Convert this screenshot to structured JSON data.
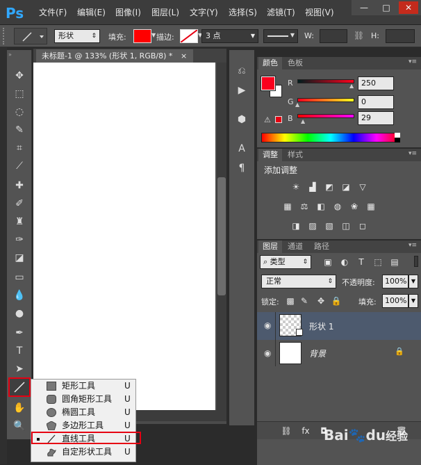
{
  "app": {
    "logo": "Ps",
    "menu": [
      "文件(F)",
      "编辑(E)",
      "图像(I)",
      "图层(L)",
      "文字(Y)",
      "选择(S)",
      "滤镜(T)",
      "视图(V)"
    ],
    "window_controls": [
      "—",
      "□",
      "✕"
    ]
  },
  "options_bar": {
    "mode_label": "形状",
    "fill_label": "填充:",
    "stroke_label": "描边:",
    "stroke_size": "3 点",
    "width_label": "W:",
    "height_label": "H:",
    "fill_color": "#ff0000",
    "accent": "#e60012"
  },
  "document": {
    "tab_title": "未标题-1 @ 133% (形状 1, RGB/8) *",
    "close_glyph": "×"
  },
  "color_panel": {
    "tabs": [
      "颜色",
      "色板"
    ],
    "r_label": "R",
    "r_value": "250",
    "g_label": "G",
    "g_value": "0",
    "b_label": "B",
    "b_value": "29",
    "foreground": "#fa001d",
    "background": "#ffffff"
  },
  "adjustments_panel": {
    "tabs": [
      "调整",
      "样式"
    ],
    "title": "添加调整"
  },
  "layers_panel": {
    "tabs": [
      "图层",
      "通道",
      "路径"
    ],
    "filter_label": "类型",
    "blend_mode": "正常",
    "opacity_label": "不透明度:",
    "opacity_value": "100%",
    "lock_label": "锁定:",
    "fill_label": "填充:",
    "fill_value": "100%",
    "layers": [
      {
        "name": "形状 1",
        "selected": true
      },
      {
        "name": "背景",
        "selected": false
      }
    ]
  },
  "flyout": {
    "items": [
      {
        "label": "矩形工具",
        "key": "U",
        "icon": "rectangle-icon"
      },
      {
        "label": "圆角矩形工具",
        "key": "U",
        "icon": "rounded-rectangle-icon"
      },
      {
        "label": "椭圆工具",
        "key": "U",
        "icon": "ellipse-icon"
      },
      {
        "label": "多边形工具",
        "key": "U",
        "icon": "polygon-icon"
      },
      {
        "label": "直线工具",
        "key": "U",
        "icon": "line-icon",
        "active": true
      },
      {
        "label": "自定形状工具",
        "key": "U",
        "icon": "custom-shape-icon"
      }
    ]
  },
  "watermark": {
    "brand": "Bai",
    "paw": "du",
    "suffix": "经验"
  }
}
